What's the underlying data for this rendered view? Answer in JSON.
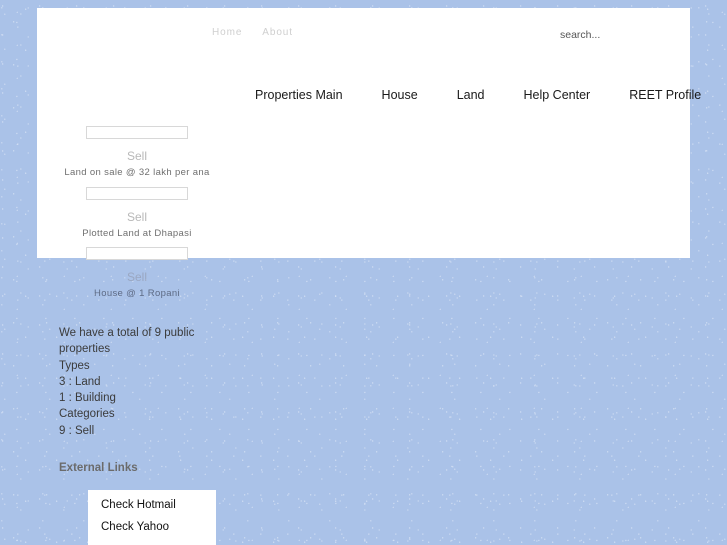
{
  "page": {
    "background_color": "#aac2e8",
    "panel_color": "#ffffff"
  },
  "top_nav": {
    "items": [
      {
        "label": "Home"
      },
      {
        "label": "About"
      }
    ]
  },
  "search": {
    "placeholder": "search...",
    "value": ""
  },
  "main_nav": {
    "items": [
      {
        "label": "Properties Main"
      },
      {
        "label": "House"
      },
      {
        "label": "Land"
      },
      {
        "label": "Help Center"
      },
      {
        "label": "REET Profile"
      }
    ]
  },
  "listings": [
    {
      "category": "Sell",
      "description": "Land on sale @ 32 lakh per ana"
    },
    {
      "category": "Sell",
      "description": "Plotted Land at Dhapasi"
    },
    {
      "category": "Sell",
      "description": "House @ 1 Ropani"
    }
  ],
  "stats": {
    "lines": [
      "We have a total of 9 public",
      "properties",
      "Types",
      "3 : Land",
      "1 : Building",
      "Categories",
      "9 : Sell"
    ]
  },
  "external_links": {
    "heading": "External Links",
    "items": [
      {
        "label": "Check Hotmail"
      },
      {
        "label": "Check Yahoo"
      }
    ]
  }
}
